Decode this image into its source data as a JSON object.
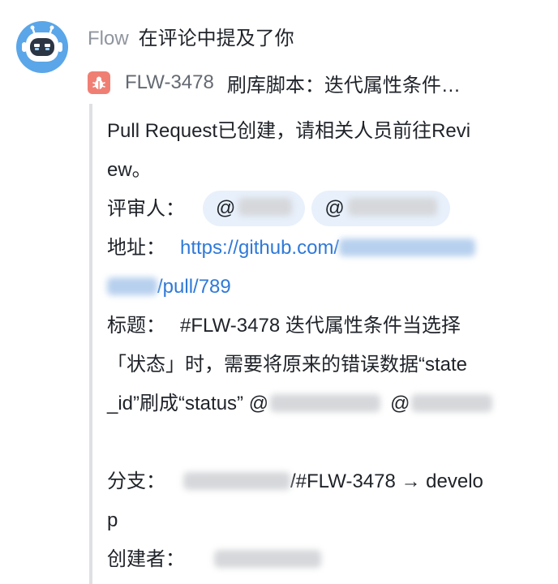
{
  "notification": {
    "sender": "Flow",
    "action": "在评论中提及了你"
  },
  "issue": {
    "icon": "bug-icon",
    "key": "FLW-3478",
    "title": "刷库脚本：迭代属性条件…"
  },
  "comment": {
    "line1": "Pull Request已创建，请相关人员前往Revi",
    "line2": "ew。",
    "reviewers_label": "评审人：",
    "reviewer_prefix": "@",
    "address_label": "地址：",
    "url_part1": "https://github.com/",
    "url_part2": "/pull/789",
    "title_label": "标题：",
    "title_line1": "#FLW-3478 迭代属性条件当选择",
    "title_line2": "「状态」时，需要将原来的错误数据“state",
    "title_line3_a": "_id”刷成“status” @",
    "title_line3_b": "@",
    "branch_label": "分支：",
    "branch_part": "/#FLW-3478 →  develo",
    "branch_line2": "p",
    "creator_label": "创建者："
  },
  "colors": {
    "avatar": "#5aa6e8",
    "bug_icon": "#f07f73",
    "link": "#2f79d9",
    "mention_bg": "#e8f0fb",
    "quote_bar": "#dee0e3"
  }
}
